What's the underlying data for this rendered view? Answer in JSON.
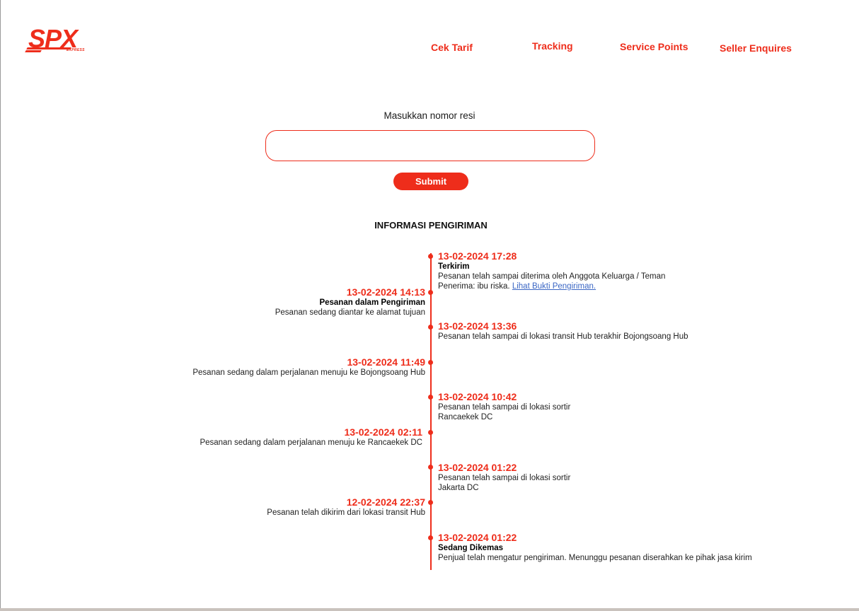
{
  "brand": {
    "logo_text": "SPX",
    "logo_sub": "EXPRESS",
    "color": "#ee2d1b"
  },
  "nav": [
    {
      "label": "Cek Tarif"
    },
    {
      "label": "Tracking"
    },
    {
      "label": "Service Points"
    },
    {
      "label": "Seller Enquires"
    }
  ],
  "form": {
    "label": "Masukkan nomor resi",
    "input_value": "",
    "submit_label": "Submit"
  },
  "section_title": "INFORMASI PENGIRIMAN",
  "timeline": [
    {
      "date": "13-02-2024 17:28",
      "status": "Terkirim",
      "lines": [
        "Pesanan telah sampai diterima oleh Anggota Keluarga / Teman",
        "Penerima: ibu riska."
      ],
      "link": "Lihat Bukti Pengiriman."
    },
    {
      "date": "13-02-2024 14:13",
      "status": "Pesanan dalam Pengiriman",
      "lines": [
        "Pesanan sedang diantar ke alamat tujuan"
      ]
    },
    {
      "date": "13-02-2024 13:36",
      "lines": [
        "Pesanan telah sampai di lokasi transit Hub terakhir Bojongsoang Hub"
      ]
    },
    {
      "date": "13-02-2024 11:49",
      "lines": [
        "Pesanan sedang dalam perjalanan menuju ke Bojongsoang Hub"
      ]
    },
    {
      "date": "13-02-2024 10:42",
      "lines": [
        "Pesanan telah sampai di lokasi sortir",
        "Rancaekek DC"
      ]
    },
    {
      "date": "13-02-2024 02:11",
      "lines": [
        "Pesanan sedang dalam perjalanan menuju ke Rancaekek DC"
      ]
    },
    {
      "date": "13-02-2024 01:22",
      "lines": [
        "Pesanan telah sampai di lokasi sortir",
        "Jakarta DC"
      ]
    },
    {
      "date": "12-02-2024 22:37",
      "lines": [
        "Pesanan telah dikirim dari lokasi transit Hub"
      ]
    },
    {
      "date": "13-02-2024 01:22",
      "status": "Sedang Dikemas",
      "lines": [
        "Penjual telah mengatur pengiriman. Menunggu pesanan diserahkan ke pihak jasa kirim"
      ]
    }
  ]
}
